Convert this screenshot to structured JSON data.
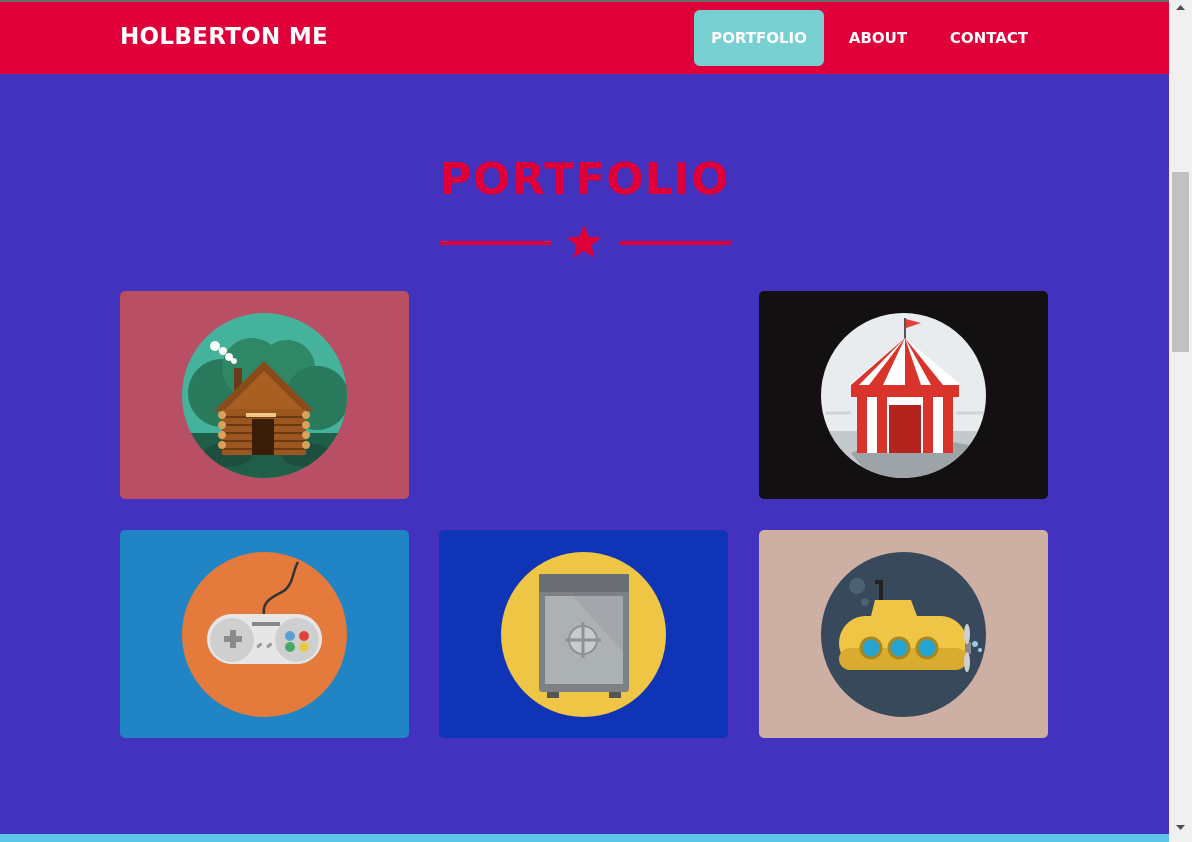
{
  "navbar": {
    "brand": "HOLBERTON ME",
    "links": [
      {
        "label": "PORTFOLIO",
        "active": true
      },
      {
        "label": "ABOUT",
        "active": false
      },
      {
        "label": "CONTACT",
        "active": false
      }
    ]
  },
  "portfolio": {
    "title": "PORTFOLIO",
    "divider_icon": "star-icon",
    "items": [
      {
        "icon": "cabin-icon",
        "background": "#b84f64"
      },
      {
        "icon": "circus-tent-icon",
        "background": "#121010"
      },
      {
        "icon": "game-controller-icon",
        "background": "#2184c4"
      },
      {
        "icon": "safe-icon",
        "background": "#0f34b6"
      },
      {
        "icon": "submarine-icon",
        "background": "#cdb0a3"
      }
    ]
  },
  "colors": {
    "page_background": "#4232bd",
    "navbar_background": "#e00039",
    "active_nav": "#79d0d2",
    "accent": "#e00039"
  }
}
